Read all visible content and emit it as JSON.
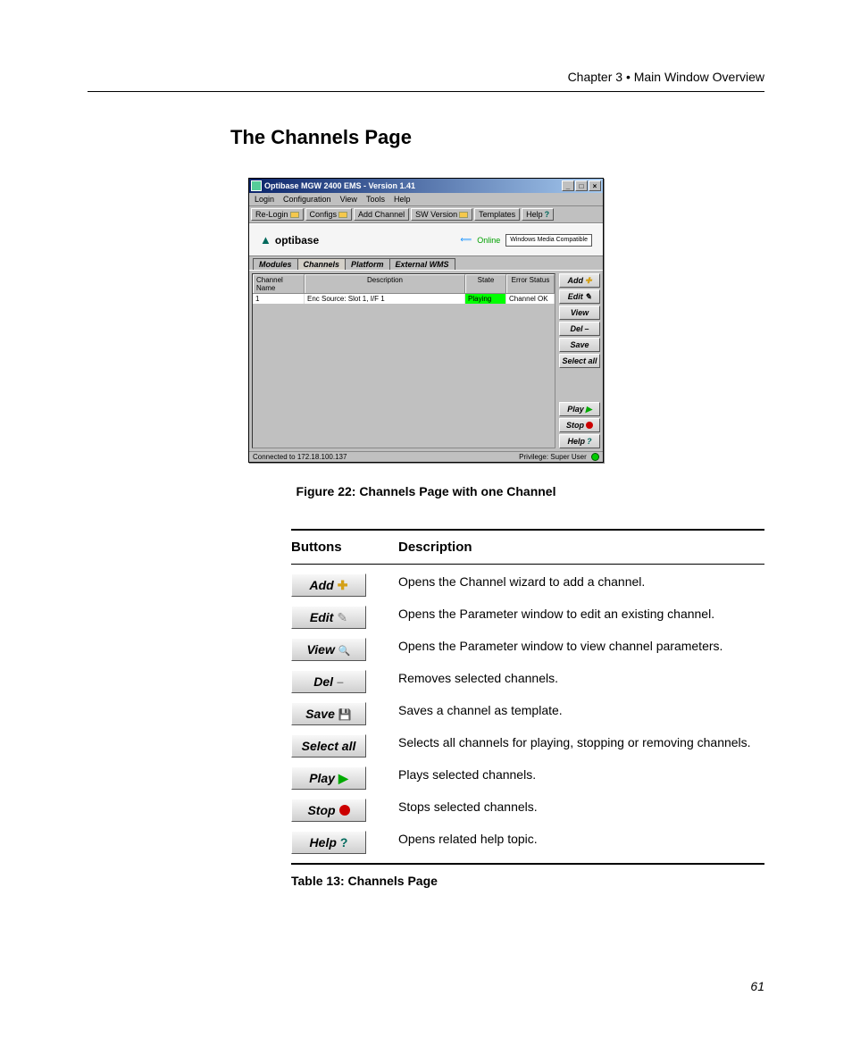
{
  "header": {
    "chapter_label": "Chapter 3",
    "bullet": "•",
    "section_label": "Main Window Overview"
  },
  "section_title": "The Channels Page",
  "figure_caption": "Figure 22: Channels Page with one Channel",
  "table_caption": "Table  13: Channels Page",
  "page_number": "61",
  "screenshot": {
    "title": "Optibase MGW 2400 EMS - Version 1.41",
    "menus": [
      "Login",
      "Configuration",
      "View",
      "Tools",
      "Help"
    ],
    "toolbar": [
      {
        "label": "Re-Login"
      },
      {
        "label": "Configs"
      },
      {
        "label": "Add Channel"
      },
      {
        "label": "SW Version"
      },
      {
        "label": "Templates"
      },
      {
        "label": "Help"
      }
    ],
    "brand": "optibase",
    "online_label": "Online",
    "winmedia": "Windows Media Compatible",
    "tabs": [
      "Modules",
      "Channels",
      "Platform",
      "External WMS"
    ],
    "active_tab": 1,
    "grid_headers": [
      "Channel Name",
      "Description",
      "State",
      "Error Status"
    ],
    "grid_row": {
      "name": "1",
      "desc": "Enc Source: Slot 1, I/F 1",
      "state": "Playing",
      "err": "Channel OK"
    },
    "side_buttons": [
      "Add",
      "Edit",
      "View",
      "Del",
      "Save",
      "Select all",
      "Play",
      "Stop",
      "Help"
    ],
    "status_left": "Connected to 172.18.100.137",
    "status_right": "Privilege: Super User"
  },
  "desc_table": {
    "head_buttons": "Buttons",
    "head_desc": "Description",
    "rows": [
      {
        "btn": "Add",
        "icon": "bp-plus",
        "desc": "Opens the Channel wizard to add a channel."
      },
      {
        "btn": "Edit",
        "icon": "ic-pencil",
        "desc": "Opens the Parameter window to edit an existing channel."
      },
      {
        "btn": "View",
        "icon": "ic-search",
        "desc": "Opens the Parameter window to view channel parameters."
      },
      {
        "btn": "Del",
        "icon": "ic-minus",
        "desc": "Removes selected channels."
      },
      {
        "btn": "Save",
        "icon": "ic-save",
        "desc": "Saves a channel as template."
      },
      {
        "btn": "Select all",
        "icon": "",
        "desc": "Selects all channels for playing, stopping or removing channels."
      },
      {
        "btn": "Play",
        "icon": "bp-play",
        "desc": "Plays selected channels."
      },
      {
        "btn": "Stop",
        "icon": "bp-stop",
        "desc": "Stops selected channels."
      },
      {
        "btn": "Help",
        "icon": "bp-q",
        "desc": "Opens related help topic."
      }
    ]
  }
}
